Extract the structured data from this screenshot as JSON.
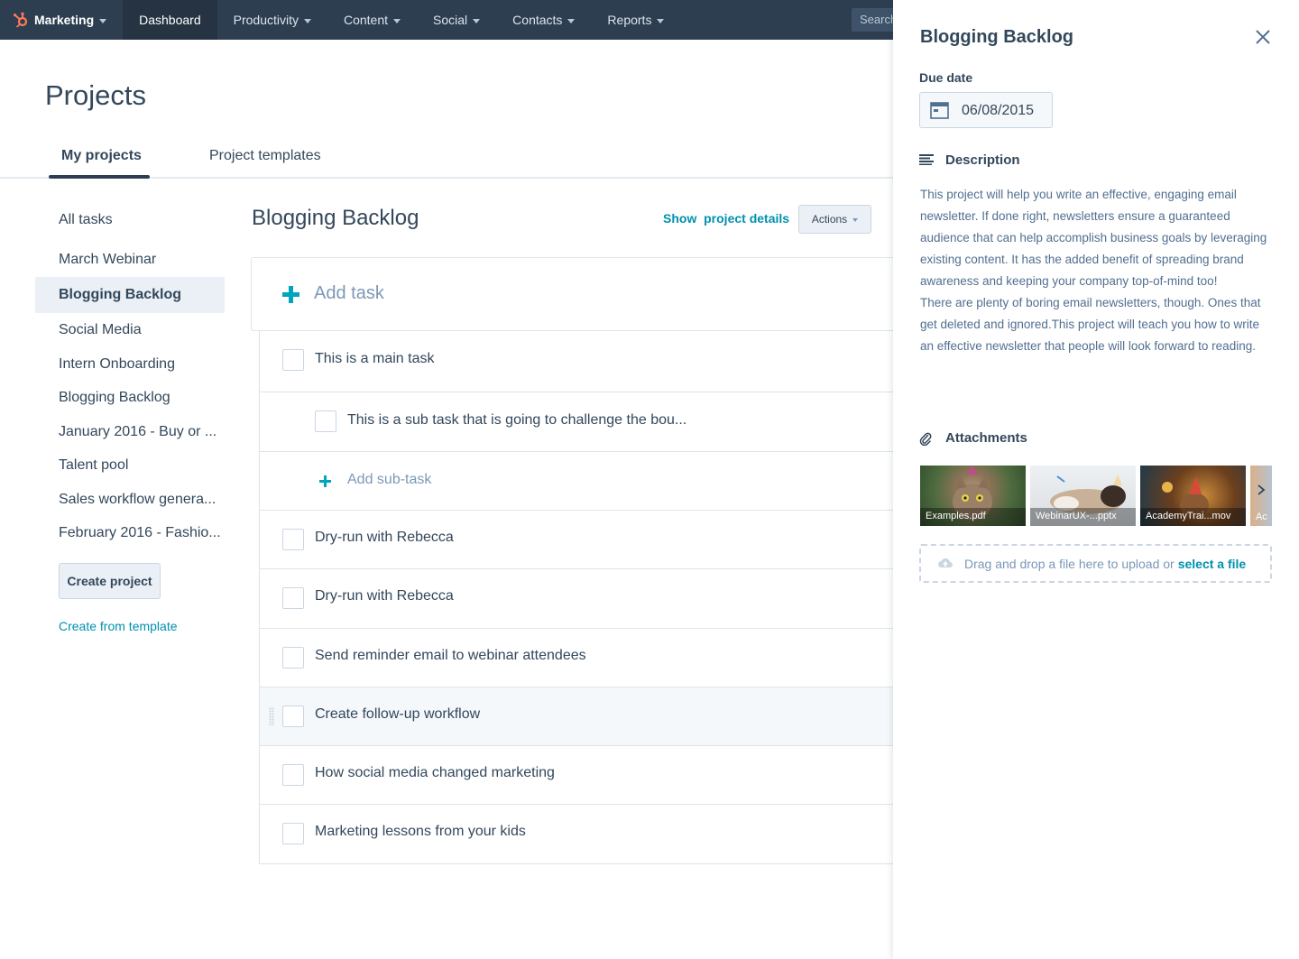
{
  "nav": {
    "brand": "Marketing",
    "items": [
      "Dashboard",
      "Productivity",
      "Content",
      "Social",
      "Contacts",
      "Reports"
    ],
    "search_placeholder": "Search"
  },
  "page": {
    "title": "Projects",
    "tabs": [
      "My projects",
      "Project templates"
    ]
  },
  "sidebar": {
    "items": [
      "All tasks",
      "March Webinar",
      "Blogging Backlog",
      "Social Media",
      "Intern Onboarding",
      "Blogging Backlog",
      "January 2016 - Buy or ...",
      "Talent pool",
      "Sales workflow genera...",
      "February 2016 - Fashio..."
    ],
    "active_index": 2,
    "create_button": "Create project",
    "template_link": "Create from template"
  },
  "main": {
    "title": "Blogging Backlog",
    "show_label": "Show",
    "project_details_label": "project details",
    "actions_label": "Actions",
    "add_task_label": "Add task",
    "tasks": [
      "This is a main task",
      "This is a sub task that is going to challenge the bou...",
      "Add sub-task",
      "Dry-run with Rebecca",
      "Dry-run with Rebecca",
      "Send reminder email to webinar attendees",
      "Create follow-up workflow",
      "How social media changed marketing",
      "Marketing lessons from your kids"
    ]
  },
  "panel": {
    "title": "Blogging Backlog",
    "due_label": "Due date",
    "due_value": "06/08/2015",
    "description_label": "Description",
    "description_p1": "This project will help you write an effective, engaging email newsletter. If done right, newsletters ensure a guaranteed audience that can help accomplish business goals by leveraging existing content. It has the added benefit of spreading brand awareness and keeping your company top-of-mind too!",
    "description_p2": "There are plenty of boring email newsletters, though. Ones that get deleted and ignored.This project will teach you how to write an effective newsletter that people will look forward to reading.",
    "attachments_label": "Attachments",
    "attachments": [
      "Examples.pdf",
      "WebinarUX-...pptx",
      "AcademyTrai...mov",
      "Ac"
    ],
    "dropzone_text": "Drag and drop a file here to upload or",
    "dropzone_link": "select a file"
  },
  "colors": {
    "nav_bg": "#2d3e50",
    "accent": "#00a4bd",
    "link": "#0091ae",
    "hubspot_orange": "#ff7a59"
  }
}
